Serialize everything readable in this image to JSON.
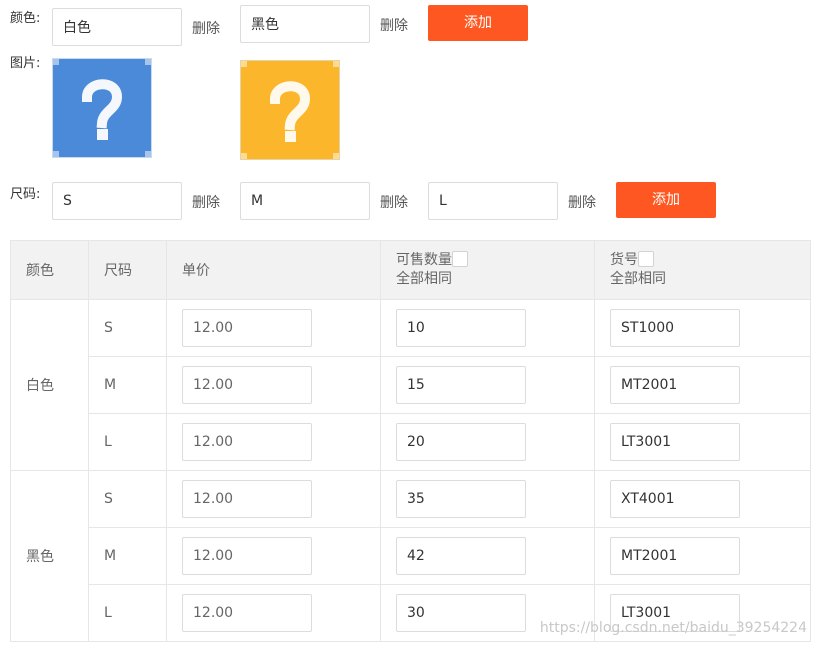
{
  "color_row": {
    "label": "颜色:",
    "values": [
      "白色",
      "黑色"
    ],
    "delete_label": "删除",
    "add_label": "添加"
  },
  "image_row": {
    "label": "图片:",
    "images": [
      {
        "icon": "question-mark-icon",
        "bg": "#4a8ad8"
      },
      {
        "icon": "question-mark-icon",
        "bg": "#fbb62b"
      }
    ]
  },
  "size_row": {
    "label": "尺码:",
    "values": [
      "S",
      "M",
      "L"
    ],
    "delete_label": "删除",
    "add_label": "添加"
  },
  "table": {
    "headers": {
      "color": "颜色",
      "size": "尺码",
      "price": "单价",
      "stock": "可售数量",
      "stock_sub": "全部相同",
      "sku": "货号",
      "sku_sub": "全部相同"
    },
    "groups": [
      {
        "color": "白色",
        "rows": [
          {
            "size": "S",
            "price": "12.00",
            "stock": "10",
            "sku": "ST1000"
          },
          {
            "size": "M",
            "price": "12.00",
            "stock": "15",
            "sku": "MT2001"
          },
          {
            "size": "L",
            "price": "12.00",
            "stock": "20",
            "sku": "LT3001"
          }
        ]
      },
      {
        "color": "黑色",
        "rows": [
          {
            "size": "S",
            "price": "12.00",
            "stock": "35",
            "sku": "XT4001"
          },
          {
            "size": "M",
            "price": "12.00",
            "stock": "42",
            "sku": "MT2001"
          },
          {
            "size": "L",
            "price": "12.00",
            "stock": "30",
            "sku": "LT3001"
          }
        ]
      }
    ]
  },
  "watermark": "https://blog.csdn.net/baidu_39254224",
  "colors": {
    "accent": "#ff5722",
    "header_bg": "#f2f2f2",
    "border": "#e6e6e6"
  }
}
